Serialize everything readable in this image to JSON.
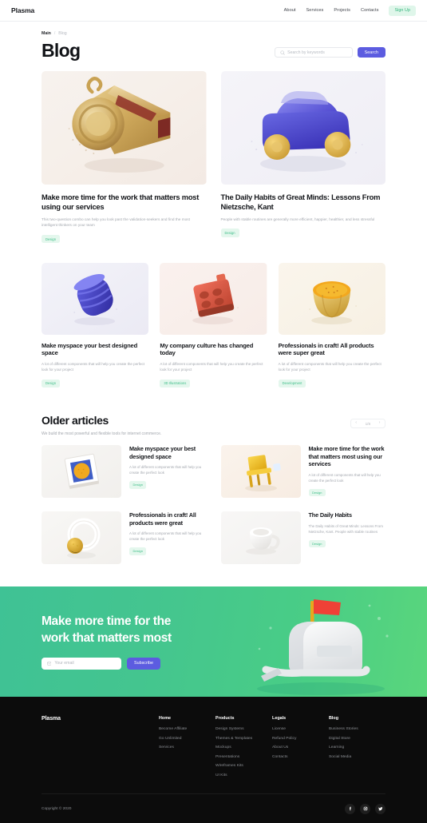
{
  "header": {
    "brand": "Plasma",
    "nav": [
      {
        "label": "About"
      },
      {
        "label": "Services"
      },
      {
        "label": "Projects"
      },
      {
        "label": "Contacts"
      }
    ],
    "signup_label": "Sign Up"
  },
  "breadcrumb": {
    "root": "Main",
    "separator": "/",
    "current": "Blog"
  },
  "page": {
    "title": "Blog"
  },
  "search": {
    "placeholder": "Search by keywords",
    "value": "",
    "button_label": "Search",
    "icon": "search-icon"
  },
  "featured": [
    {
      "title": "Make more time for the work that matters most using our services",
      "desc": "This two-question combo can help you look past the validation-seekers and find the most intelligent thinkers on your team",
      "tag": "Design",
      "image": "gold-whistle-3d"
    },
    {
      "title": "The Daily Habits of Great Minds: Lessons From Nietzsche, Kant",
      "desc": "People with stable routines are generally more efficient, happier, healthier, and less stressful",
      "tag": "Design",
      "image": "blue-toy-car-3d"
    }
  ],
  "secondary": [
    {
      "title": "Make myspace your best designed space",
      "desc": "A lot of different components that will help you create the perfect look for your project",
      "tag": "Design",
      "image": "blue-coil-3d"
    },
    {
      "title": "My company culture has changed today",
      "desc": "A lot of different components that will help you create the perfect look for your project",
      "tag": "3D Illustrations",
      "image": "red-block-3d"
    },
    {
      "title": "Professionals in craft! All products were super great",
      "desc": "A lot of different components that will help you create the perfect look for your project",
      "tag": "Development",
      "image": "gold-bowl-3d"
    }
  ],
  "older": {
    "title": "Older articles",
    "subtitle": "We build the most powerful and flexible tools for internet commerce.",
    "pagination": {
      "prev": "‹",
      "next": "›",
      "count": "1/8"
    },
    "items": [
      {
        "title": "Make myspace your best designed space",
        "desc": "A lot of different components that will help you create the perfect look",
        "tag": "Design",
        "image": "white-frame-orange-dot-3d"
      },
      {
        "title": "Make more time for the work that matters most using our services",
        "desc": "A lot of different components that will help you create the perfect look",
        "tag": "Design",
        "image": "yellow-chair-3d"
      },
      {
        "title": "Professionals in craft! All products were great",
        "desc": "A lot of different components that will help you create the perfect look",
        "tag": "Design",
        "image": "white-ring-gold-ball-3d"
      },
      {
        "title": "The Daily Habits",
        "desc": "The Daily Habits of Great Minds: Lessons From Nietzsche, Kant. People with stable routines",
        "tag": "Design",
        "image": "white-cup-3d"
      }
    ]
  },
  "cta": {
    "headline": "Make more time for the work that matters most",
    "email_placeholder": "Your email",
    "email_value": "",
    "email_icon": "envelope-icon",
    "subscribe_label": "Subscribe",
    "art": "white-mailbox-red-flag-3d",
    "gradient_from": "#3fc295",
    "gradient_to": "#5ad67c"
  },
  "footer": {
    "brand": "Plasma",
    "columns": [
      {
        "heading": "Home",
        "links": [
          "Become Affiliate",
          "Go Unlimited",
          "Services"
        ]
      },
      {
        "heading": "Products",
        "links": [
          "Design Systems",
          "Themes & Templates",
          "Mockups",
          "Presentations",
          "Wireframes Kits",
          "UI Kits"
        ]
      },
      {
        "heading": "Legals",
        "links": [
          "License",
          "Refund Policy",
          "About Us",
          "Contacts"
        ]
      },
      {
        "heading": "Blog",
        "links": [
          "Business Stories",
          "Digital Store",
          "Learning",
          "Social Media"
        ]
      }
    ],
    "copyright": "Copyright © 2020",
    "socials": [
      "facebook-icon",
      "instagram-icon",
      "twitter-icon"
    ]
  },
  "colors": {
    "accent": "#5c5ce0",
    "tag_bg": "#e4f7ed",
    "tag_text": "#3cbd87",
    "signup_bg": "#dff6ea",
    "footer_bg": "#0c0c0c"
  }
}
